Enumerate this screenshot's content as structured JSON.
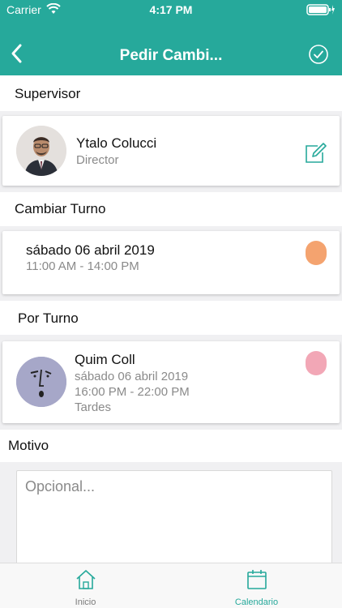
{
  "status_bar": {
    "carrier": "Carrier",
    "time": "4:17 PM"
  },
  "header": {
    "title": "Pedir Cambi...",
    "back_icon": "chevron-left-icon",
    "confirm_icon": "check-circle-icon",
    "bg_color": "#26a99b"
  },
  "supervisor": {
    "section_label": "Supervisor",
    "name": "Ytalo Colucci",
    "role": "Director",
    "edit_icon": "edit-icon"
  },
  "cambiar_turno": {
    "section_label": "Cambiar Turno",
    "date": "sábado 06 abril 2019",
    "time": "11:00 AM  - 14:00 PM",
    "color": "#f4a36f"
  },
  "por_turno": {
    "section_label": "Por Turno",
    "name": "Quim Coll",
    "date": "sábado 06 abril 2019",
    "time": "16:00 PM  - 22:00 PM",
    "shift": "Tardes",
    "color": "#f2a7b6"
  },
  "motivo": {
    "section_label": "Motivo",
    "placeholder": "Opcional..."
  },
  "tabbar": {
    "tabs": [
      {
        "label": "Inicio",
        "icon": "home-icon",
        "active": false
      },
      {
        "label": "Calendario",
        "icon": "calendar-icon",
        "active": true
      }
    ],
    "active_color": "#26a99b",
    "inactive_color": "#7a7a7a"
  }
}
